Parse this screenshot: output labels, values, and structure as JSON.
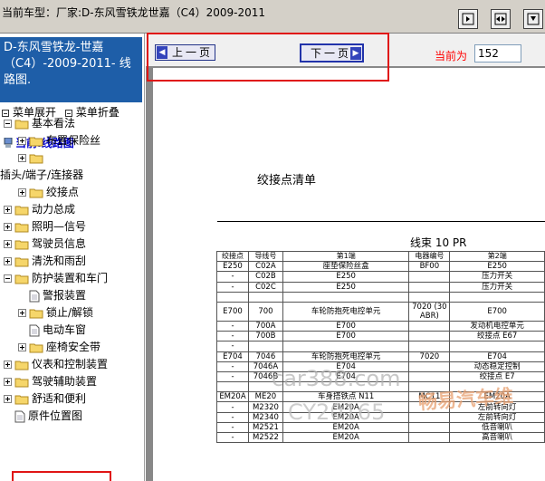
{
  "topbar": {
    "title": "当前车型：厂家:D-东风雪铁龙世嘉（C4）2009-2011"
  },
  "left": {
    "model_box": "D-东风雪铁龙-世嘉（C4）-2009-2011- 线路图.",
    "expand_label": "菜单展开",
    "collapse_label": "菜单折叠",
    "tree_root": "当前:线路图",
    "tree": [
      {
        "label": "基本看法",
        "kind": "folder",
        "expander": "minus"
      },
      {
        "label": "布置保险丝",
        "kind": "folder",
        "expander": "plus"
      },
      {
        "label": "",
        "kind": "folder",
        "expander": "plus"
      },
      {
        "label": "插头/端子/连接器",
        "kind": "text",
        "expander": "none"
      },
      {
        "label": "绞接点",
        "kind": "folder",
        "expander": "plus"
      },
      {
        "label": "动力总成",
        "kind": "folder",
        "expander": "plus"
      },
      {
        "label": "照明—信号",
        "kind": "folder",
        "expander": "plus"
      },
      {
        "label": "驾驶员信息",
        "kind": "folder",
        "expander": "plus"
      },
      {
        "label": "清洗和雨刮",
        "kind": "folder",
        "expander": "plus"
      },
      {
        "label": "防护装置和车门",
        "kind": "folder",
        "expander": "minus"
      },
      {
        "label": "警报装置",
        "kind": "doc",
        "expander": "none"
      },
      {
        "label": "锁止/解锁",
        "kind": "folder",
        "expander": "plus"
      },
      {
        "label": "电动车窗",
        "kind": "doc",
        "expander": "none"
      },
      {
        "label": "座椅安全带",
        "kind": "folder",
        "expander": "plus"
      },
      {
        "label": "仪表和控制装置",
        "kind": "folder",
        "expander": "plus"
      },
      {
        "label": "驾驶辅助装置",
        "kind": "folder",
        "expander": "plus"
      },
      {
        "label": "舒适和便利",
        "kind": "folder",
        "expander": "plus"
      },
      {
        "label": "原件位置图",
        "kind": "doc",
        "expander": "none"
      }
    ]
  },
  "nav": {
    "prev_label": "上一页",
    "next_label": "下一页",
    "current_label": "当前为",
    "page_value": "152"
  },
  "document": {
    "title": "绞接点清单",
    "harness": "线束  10 PR",
    "headers": [
      "绞接点",
      "导线号",
      "第1端",
      "电器编号",
      "第2端"
    ],
    "rows": [
      [
        "E250",
        "C02A",
        "座垫保险丝盒",
        "BF00",
        "E250"
      ],
      [
        "-",
        "C02B",
        "E250",
        "",
        "压力开关"
      ],
      [
        "-",
        "C02C",
        "E250",
        "",
        "压力开关"
      ],
      [
        "",
        "",
        "",
        "",
        ""
      ],
      [
        "E700",
        "700",
        "车轮防抱死电控单元",
        "7020 (30 ABR)",
        "E700"
      ],
      [
        "-",
        "700A",
        "E700",
        "",
        "发动机电控单元"
      ],
      [
        "-",
        "700B",
        "E700",
        "",
        "绞接点 E67"
      ],
      [
        "-",
        "",
        "",
        "",
        ""
      ],
      [
        "E704",
        "7046",
        "车轮防抱死电控单元",
        "7020",
        "E704"
      ],
      [
        "-",
        "7046A",
        "E704",
        "",
        "动态稳定控制"
      ],
      [
        "-",
        "7046B",
        "E704",
        "",
        "绞接点 E7"
      ],
      [
        "",
        "",
        "",
        "",
        ""
      ],
      [
        "EM20A",
        "ME20",
        "车身搭铁点 N11",
        "MC11",
        "EM20A"
      ],
      [
        "-",
        "M2320",
        "EM20A",
        "",
        "左前转向灯"
      ],
      [
        "-",
        "M2340",
        "EM20A",
        "",
        "左前转向灯"
      ],
      [
        "-",
        "M2521",
        "EM20A",
        "",
        "低音喇叭"
      ],
      [
        "-",
        "M2522",
        "EM20A",
        "",
        "高音喇叭"
      ]
    ]
  },
  "watermarks": {
    "site": "car388.com",
    "code": "CY20165",
    "brand": "畅易汽车维"
  },
  "colors": {
    "window_gray": "#d4d0c8",
    "model_box_blue": "#1e5ea8",
    "highlight_red": "#e01515",
    "current_label_red": "#ff0000",
    "viewer_gray": "#888888"
  }
}
